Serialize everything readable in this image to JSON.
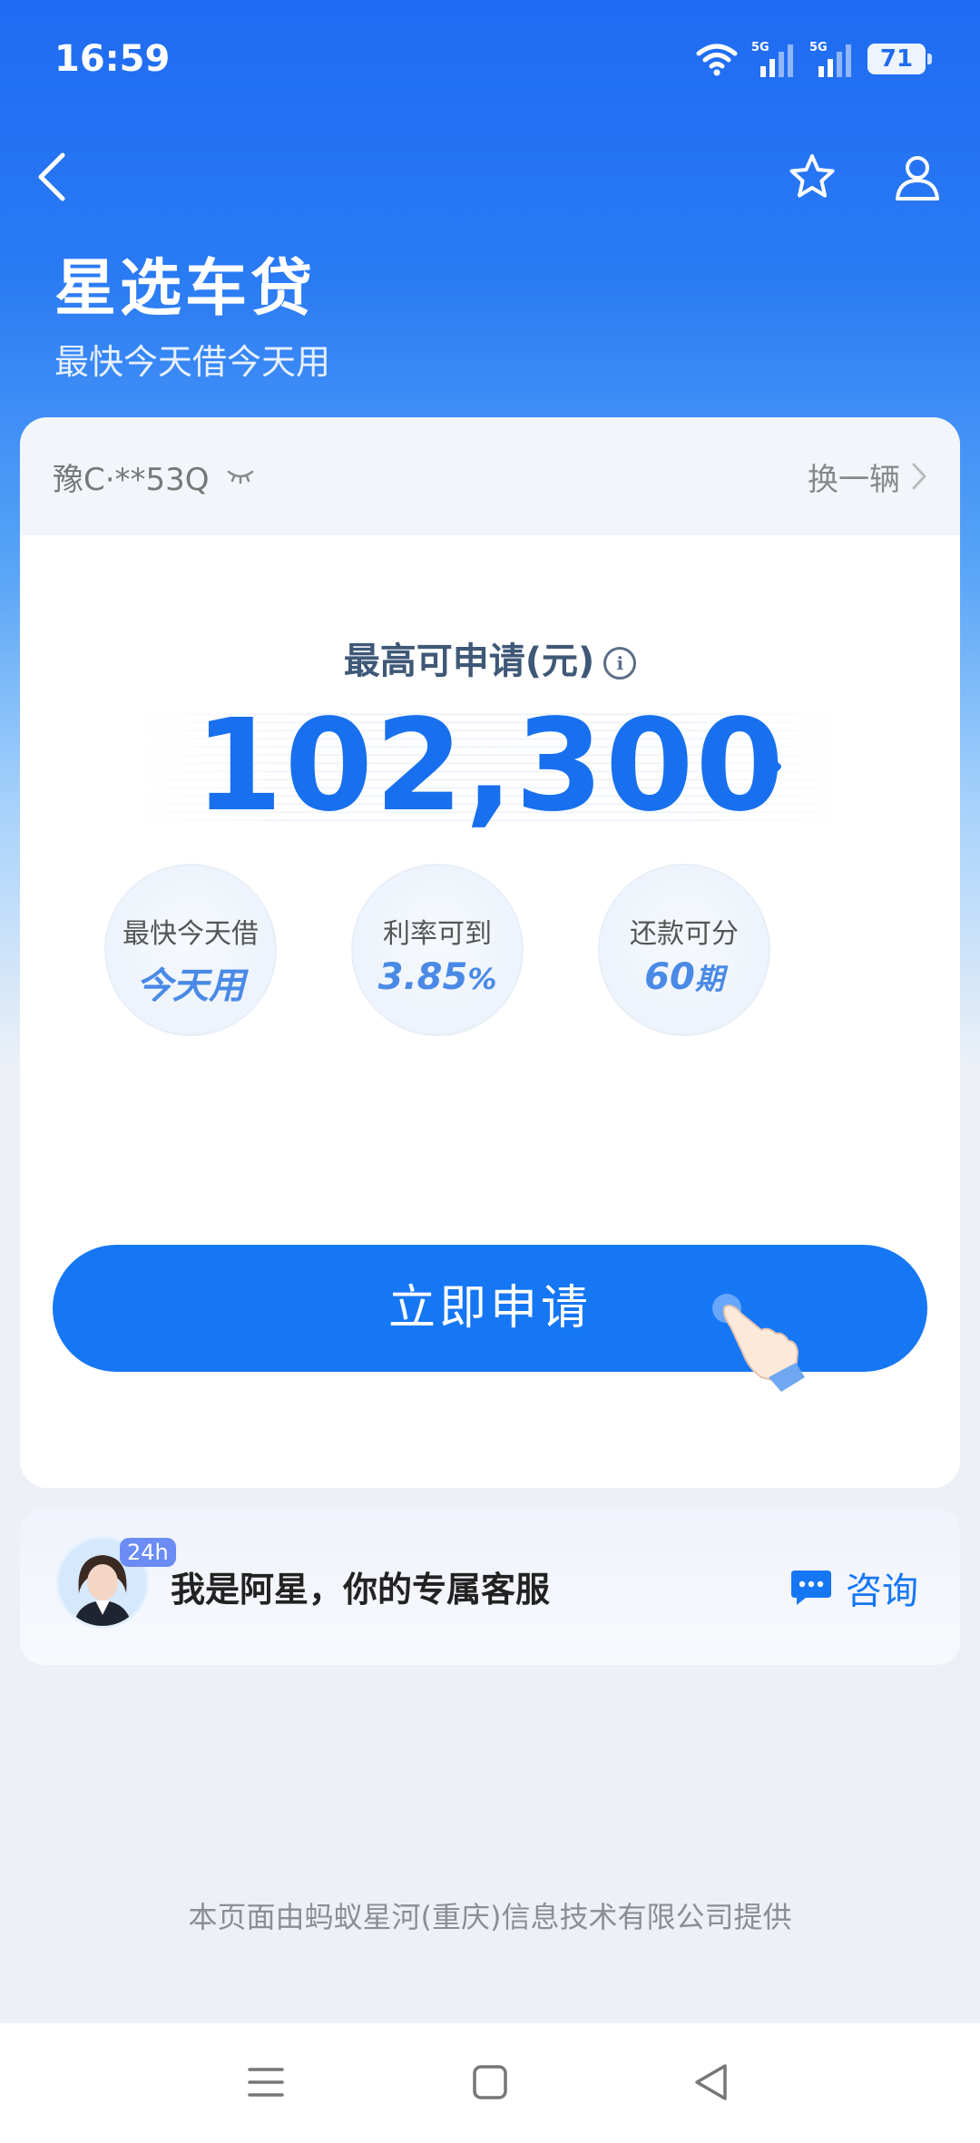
{
  "status_bar": {
    "time": "16:59",
    "battery": "71",
    "signal1": "5G",
    "signal2": "5G"
  },
  "header": {
    "title": "星选车贷",
    "subtitle": "最快今天借今天用"
  },
  "vehicle": {
    "plate": "豫C·**53Q",
    "switch_label": "换一辆"
  },
  "loan": {
    "amount_label": "最高可申请(元)",
    "amount": "102,300",
    "features": [
      {
        "label": "最快今天借",
        "value": "今天用",
        "unit": ""
      },
      {
        "label": "利率可到",
        "value": "3.85",
        "unit": "%"
      },
      {
        "label": "还款可分",
        "value": "60",
        "unit": "期"
      }
    ],
    "apply_label": "立即申请"
  },
  "service": {
    "badge": "24h",
    "text": "我是阿星，你的专属客服",
    "consult_label": "咨询"
  },
  "footer": {
    "note": "本页面由蚂蚁星河(重庆)信息技术有限公司提供"
  },
  "colors": {
    "primary": "#1677f5",
    "amount": "#1870ee",
    "header_bg": "#1f6bf2"
  }
}
